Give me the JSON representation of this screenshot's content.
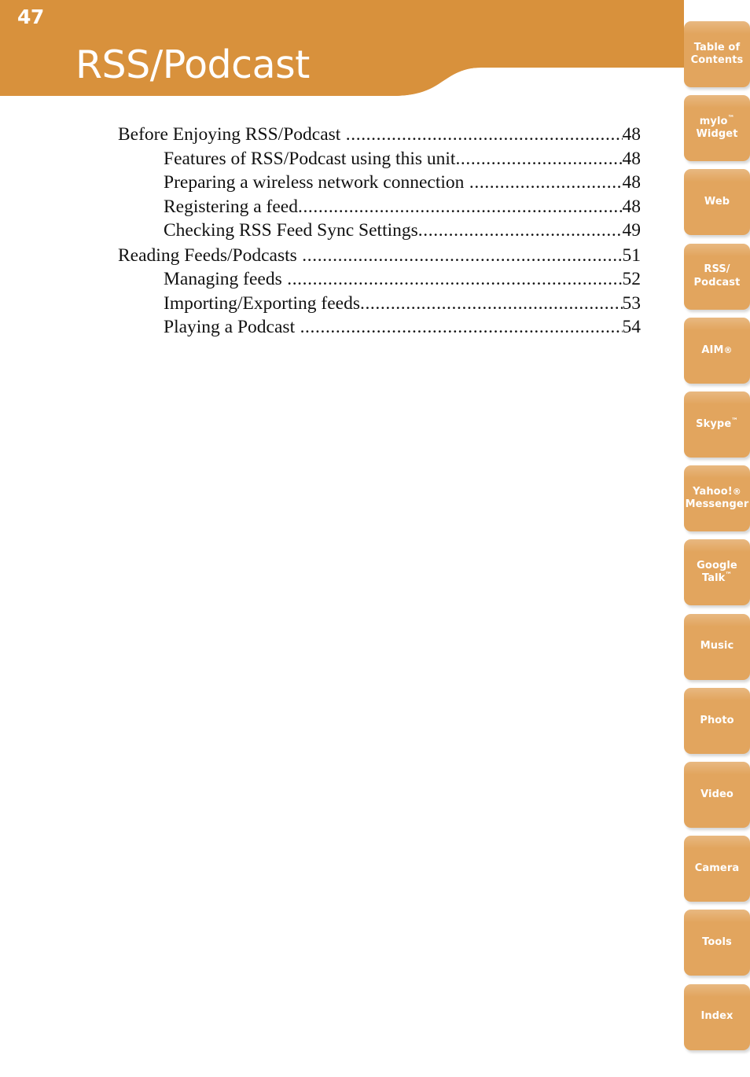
{
  "page": {
    "number": "47",
    "title": "RSS/Podcast"
  },
  "colors": {
    "header_orange": "#d8913c",
    "tab_orange": "#e2a55e",
    "text_black": "#111111",
    "tab_text": "#ffffff"
  },
  "toc": {
    "entries": [
      {
        "label": "Before Enjoying RSS/Podcast",
        "page": "48",
        "level": 1,
        "space_before_dots": true
      },
      {
        "label": "Features of RSS/Podcast using this unit",
        "page": "48",
        "level": 2,
        "space_before_dots": false
      },
      {
        "label": "Preparing a wireless network connection",
        "page": "48",
        "level": 2,
        "space_before_dots": true
      },
      {
        "label": "Registering a feed",
        "page": "48",
        "level": 2,
        "space_before_dots": false
      },
      {
        "label": "Checking RSS Feed Sync Settings",
        "page": "49",
        "level": 2,
        "space_before_dots": false
      },
      {
        "label": "Reading Feeds/Podcasts",
        "page": "51",
        "level": 1,
        "space_before_dots": true
      },
      {
        "label": "Managing feeds",
        "page": "52",
        "level": 2,
        "space_before_dots": true
      },
      {
        "label": "Importing/Exporting feeds",
        "page": "53",
        "level": 2,
        "space_before_dots": false
      },
      {
        "label": "Playing a Podcast",
        "page": "54",
        "level": 2,
        "space_before_dots": true
      }
    ],
    "leader_dots": "...................................................................................................................................................."
  },
  "tabs": [
    {
      "lines": [
        "Table of",
        "Contents"
      ],
      "name": "table-of-contents"
    },
    {
      "lines": [
        "mylo™",
        "Widget"
      ],
      "name": "mylo-widget"
    },
    {
      "lines": [
        "Web"
      ],
      "name": "web"
    },
    {
      "lines": [
        "RSS/",
        "Podcast"
      ],
      "name": "rss-podcast"
    },
    {
      "lines": [
        "AIM®"
      ],
      "name": "aim"
    },
    {
      "lines": [
        "Skype™"
      ],
      "name": "skype"
    },
    {
      "lines": [
        "Yahoo!®",
        "Messenger"
      ],
      "name": "yahoo-messenger"
    },
    {
      "lines": [
        "Google",
        "Talk™"
      ],
      "name": "google-talk"
    },
    {
      "lines": [
        "Music"
      ],
      "name": "music"
    },
    {
      "lines": [
        "Photo"
      ],
      "name": "photo"
    },
    {
      "lines": [
        "Video"
      ],
      "name": "video"
    },
    {
      "lines": [
        "Camera"
      ],
      "name": "camera"
    },
    {
      "lines": [
        "Tools"
      ],
      "name": "tools"
    },
    {
      "lines": [
        "Index"
      ],
      "name": "index"
    }
  ]
}
